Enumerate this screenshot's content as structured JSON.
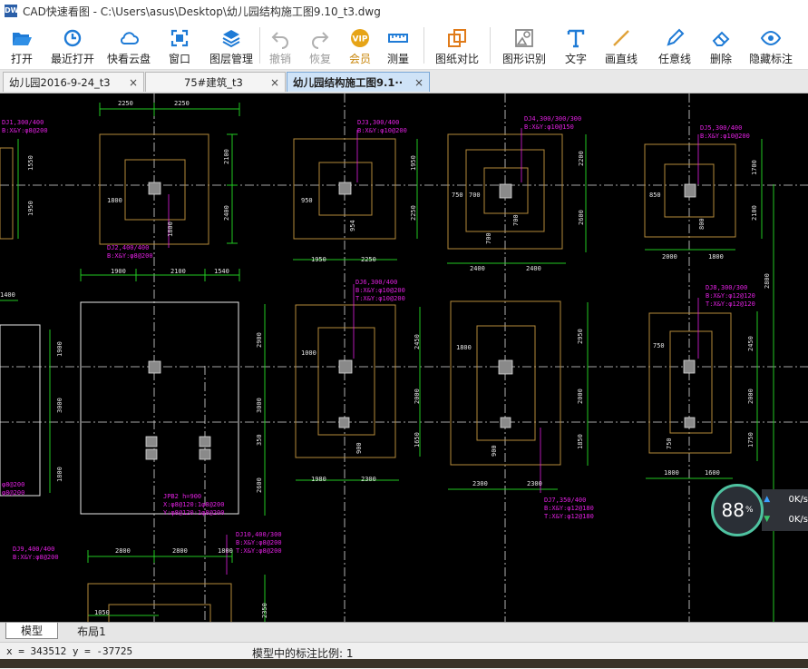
{
  "window": {
    "title": "CAD快速看图 - C:\\Users\\asus\\Desktop\\幼儿园结构施工图9.10_t3.dwg",
    "logo_text": "DWG"
  },
  "toolbar": {
    "items": [
      {
        "label": "打开",
        "icon": "folder-open-icon"
      },
      {
        "label": "最近打开",
        "icon": "recent-clock-icon"
      },
      {
        "label": "快看云盘",
        "icon": "cloud-icon"
      },
      {
        "label": "窗口",
        "icon": "window-fit-icon"
      },
      {
        "label": "图层管理",
        "icon": "layers-icon"
      },
      {
        "label": "撤销",
        "icon": "undo-icon"
      },
      {
        "label": "恢复",
        "icon": "redo-icon"
      },
      {
        "label": "会员",
        "icon": "vip-icon"
      },
      {
        "label": "测量",
        "icon": "ruler-icon"
      },
      {
        "label": "图纸对比",
        "icon": "compare-icon"
      },
      {
        "label": "图形识别",
        "icon": "shape-recognize-icon"
      },
      {
        "label": "文字",
        "icon": "text-icon"
      },
      {
        "label": "画直线",
        "icon": "line-icon"
      },
      {
        "label": "任意线",
        "icon": "pen-icon"
      },
      {
        "label": "删除",
        "icon": "eraser-icon"
      },
      {
        "label": "隐藏标注",
        "icon": "eye-icon"
      }
    ]
  },
  "tabs": [
    {
      "label": "幼儿园2016-9-24_t3",
      "close": "×"
    },
    {
      "label": "75#建筑_t3",
      "close": "×"
    },
    {
      "label": "幼儿园结构施工图9.1··",
      "close": "×"
    }
  ],
  "drawing": {
    "labels": {
      "dj1": "DJ1,300/400",
      "dj1b": "B:X&Y:φ8@200",
      "dj2": "DJ2,400/400",
      "dj2b": "B:X&Y:φ8@200",
      "dj3": "DJ3,300/400",
      "dj3b": "B:X&Y:φ10@200",
      "dj4": "DJ4,300/300/300",
      "dj4b": "B:X&Y:φ10@150",
      "dj5": "DJ5,300/400",
      "dj5b": "B:X&Y:φ10@200",
      "dj6": "DJ6,300/400",
      "dj6b": "B:X&Y:φ10@200",
      "dj6t": "T:X&Y:φ10@200",
      "dj7": "DJ7,350/400",
      "dj7b": "B:X&Y:φ12@180",
      "dj7t": "T:X&Y:φ12@180",
      "dj8": "DJ8,300/300",
      "dj8b": "B:X&Y:φ12@120",
      "dj8t": "T:X&Y:φ12@120",
      "dj9": "DJ9,400/400",
      "dj9b": "B:X&Y:φ8@200",
      "dj10": "DJ10,400/300",
      "dj10b": "B:X&Y:φ8@200",
      "dj10t": "T:X&Y:φ8@200",
      "jpb": "JPB2 h=900",
      "jpb1": "X:φ8@120:1φ8@200",
      "jpb2": "Y:φ8@120:1φ8@200",
      "side_b": "φ8@200",
      "side_b2": "φ8@200"
    },
    "dims": {
      "d2250a": "2250",
      "d2250b": "2250",
      "d2100a": "2100",
      "d2400a": "2400",
      "d1800a": "1800",
      "d1800b": "1800",
      "d1550": "1550",
      "d1950": "1950",
      "d950": "950",
      "d1950b": "1950",
      "d2250c": "2250",
      "d1950c": "1950",
      "d2250d": "2250",
      "d954": "954",
      "d2200": "2200",
      "d2600": "2600",
      "d2400b": "2400",
      "d2400c": "2400",
      "d750": "750",
      "d700": "700",
      "d700b": "700",
      "d700c": "700",
      "d1700": "1700",
      "d2100b": "2100",
      "d850": "850",
      "d2000": "2000",
      "d1800c": "1800",
      "d800": "800",
      "d2800": "2800",
      "d1900": "1900",
      "d2100c": "2100",
      "d1540": "1540",
      "d1400": "1400",
      "d2900": "2900",
      "d3000": "3000",
      "d350": "350",
      "d3000b": "3000",
      "d1900b": "1900",
      "d1800d": "1800",
      "d2600b": "2600",
      "d1000": "1000",
      "d2450": "2450",
      "d2000b": "2000",
      "d1650": "1650",
      "d1980": "1980",
      "d2300": "2300",
      "d900": "900",
      "d1800e": "1800",
      "d2950": "2950",
      "d2000c": "2000",
      "d1850": "1850",
      "d2300b": "2300",
      "d2300c": "2300",
      "d900b": "900",
      "d750b": "750",
      "d2450b": "2450",
      "d2000d": "2000",
      "d1750": "1750",
      "d1800f": "1800",
      "d1600": "1600",
      "d750c": "750",
      "d2800b": "2800",
      "d2800c": "2800",
      "d1800g": "1800",
      "d1050": "1050",
      "d2350": "2350"
    }
  },
  "layout_tabs": [
    {
      "label": "模型"
    },
    {
      "label": "布局1"
    }
  ],
  "status": {
    "coords": "x = 343512  y = -37725",
    "scale": "模型中的标注比例: 1"
  },
  "net_widget": {
    "percent": "88",
    "unit": "%",
    "up": "0K/s",
    "down": "0K/s"
  }
}
